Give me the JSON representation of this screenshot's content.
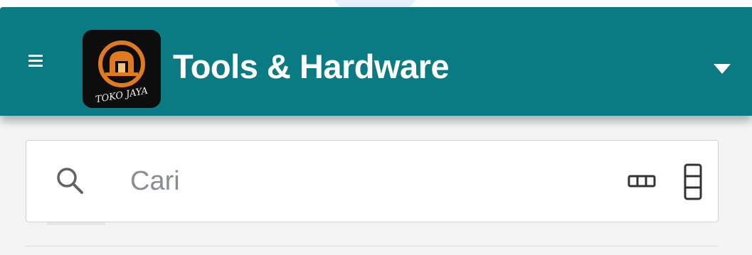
{
  "app_bar": {
    "title": "Tools & Hardware",
    "background_color": "#0a7a83",
    "menu_icon": "hamburger-menu-icon",
    "dropdown_icon": "triangle-down-icon"
  },
  "logo": {
    "text": "TOKO JAYA",
    "accent_color": "#e07a1f"
  },
  "search": {
    "placeholder": "Cari",
    "value": "",
    "icon": "search-icon",
    "view_toggle_icons": [
      "horizontal-layout-icon",
      "vertical-layout-icon"
    ]
  }
}
